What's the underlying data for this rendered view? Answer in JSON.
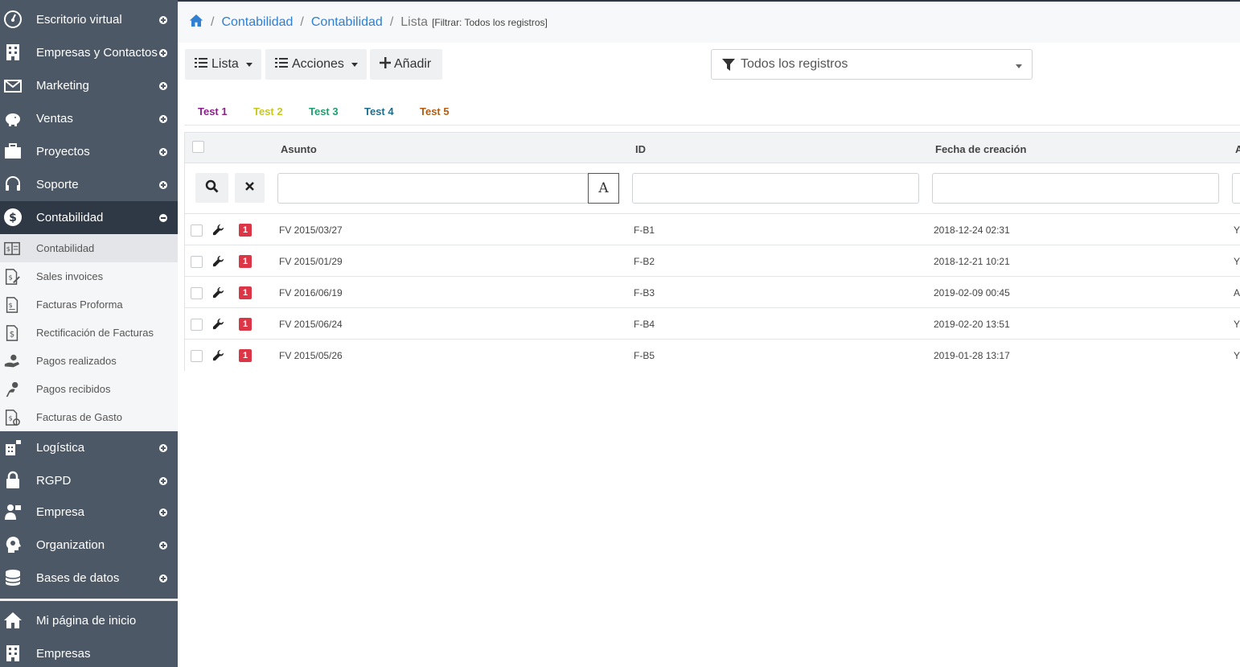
{
  "sidebar": {
    "top_items": [
      {
        "label": "Escritorio virtual",
        "icon": "dashboard-icon",
        "state": "collapsed"
      },
      {
        "label": "Empresas y Contactos",
        "icon": "building-icon",
        "state": "collapsed"
      },
      {
        "label": "Marketing",
        "icon": "mail-icon",
        "state": "collapsed"
      },
      {
        "label": "Ventas",
        "icon": "piggy-bank-icon",
        "state": "collapsed"
      },
      {
        "label": "Proyectos",
        "icon": "briefcase-icon",
        "state": "collapsed"
      },
      {
        "label": "Soporte",
        "icon": "headset-icon",
        "state": "collapsed"
      },
      {
        "label": "Contabilidad",
        "icon": "dollar-icon",
        "state": "expanded"
      }
    ],
    "sub_items": [
      {
        "label": "Contabilidad",
        "icon": "ledger-icon",
        "active": true
      },
      {
        "label": "Sales invoices",
        "icon": "invoice-pen-icon",
        "active": false
      },
      {
        "label": "Facturas Proforma",
        "icon": "invoice-icon",
        "active": false
      },
      {
        "label": "Rectificación de Facturas",
        "icon": "invoice-dollar-icon",
        "active": false
      },
      {
        "label": "Pagos realizados",
        "icon": "hand-coin-icon",
        "active": false
      },
      {
        "label": "Pagos recibidos",
        "icon": "hand-receive-icon",
        "active": false
      },
      {
        "label": "Facturas de Gasto",
        "icon": "expense-invoice-icon",
        "active": false
      }
    ],
    "bottom_items": [
      {
        "label": "Logística",
        "icon": "warehouse-icon",
        "state": "collapsed"
      },
      {
        "label": "RGPD",
        "icon": "lock-icon",
        "state": "collapsed"
      },
      {
        "label": "Empresa",
        "icon": "users-icon",
        "state": "collapsed"
      },
      {
        "label": "Organization",
        "icon": "org-head-icon",
        "state": "collapsed"
      },
      {
        "label": "Bases de datos",
        "icon": "database-icon",
        "state": "collapsed"
      }
    ],
    "quick_items": [
      {
        "label": "Mi página de inicio",
        "icon": "home-icon"
      },
      {
        "label": "Empresas",
        "icon": "building-icon"
      }
    ]
  },
  "breadcrumb": {
    "home_icon": "home-icon",
    "items": [
      "Contabilidad",
      "Contabilidad"
    ],
    "current": "Lista",
    "filter_note": "[Filtrar: Todos los registros]"
  },
  "toolbar": {
    "list_label": "Lista",
    "actions_label": "Acciones",
    "add_label": "Añadir"
  },
  "filter_select": {
    "value": "Todos los registros",
    "icon": "filter-icon"
  },
  "tags": [
    {
      "label": "Test 1",
      "color": "#8e1e8e"
    },
    {
      "label": "Test 2",
      "color": "#c7c81e"
    },
    {
      "label": "Test 3",
      "color": "#1e9e6e"
    },
    {
      "label": "Test 4",
      "color": "#1e6e8e"
    },
    {
      "label": "Test 5",
      "color": "#b35c10"
    }
  ],
  "table": {
    "columns": [
      "Asunto",
      "ID",
      "Fecha de creación",
      "A"
    ],
    "filter_mode_label": "A",
    "rows": [
      {
        "asunto": "FV 2015/03/27",
        "id": "F-B1",
        "fecha": "2018-12-24 02:31",
        "extra": "Y",
        "badge": "1"
      },
      {
        "asunto": "FV 2015/01/29",
        "id": "F-B2",
        "fecha": "2018-12-21 10:21",
        "extra": "Y",
        "badge": "1"
      },
      {
        "asunto": "FV 2016/06/19",
        "id": "F-B3",
        "fecha": "2019-02-09 00:45",
        "extra": "A",
        "badge": "1"
      },
      {
        "asunto": "FV 2015/06/24",
        "id": "F-B4",
        "fecha": "2019-02-20 13:51",
        "extra": "Y",
        "badge": "1"
      },
      {
        "asunto": "FV 2015/05/26",
        "id": "F-B5",
        "fecha": "2019-01-28 13:17",
        "extra": "Y",
        "badge": "1"
      }
    ]
  },
  "colors": {
    "sidebar_bg": "#4d5866",
    "sidebar_active": "#2f3845",
    "link": "#2f7fd3",
    "badge": "#dc3545"
  }
}
